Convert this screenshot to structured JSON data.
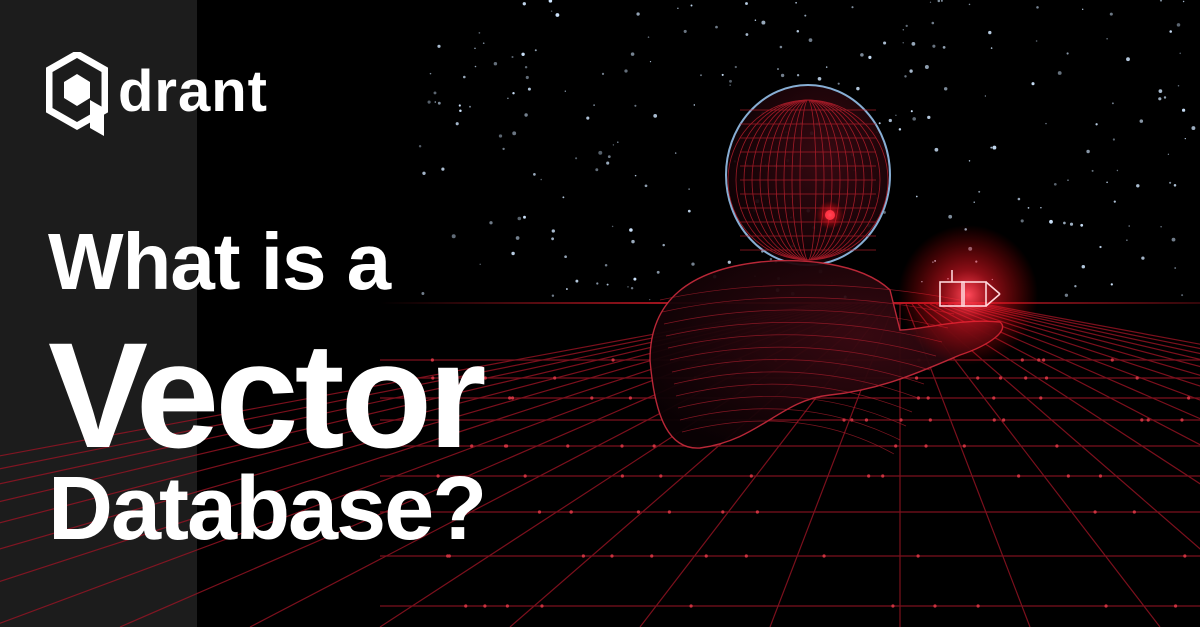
{
  "brand": {
    "name": "drant",
    "logo_icon": "qdrant-hexagon-q-icon",
    "colors": {
      "primary_text": "#ffffff",
      "accent_glow": "#ff1a3a",
      "panel_bg": "#1c1c1c",
      "background": "#000000"
    }
  },
  "headline": {
    "line1": "What is a",
    "line2": "Vector",
    "line3": "Database?"
  },
  "illustration": {
    "description_icon": "wireframe-figure-holding-glowing-cube-icon"
  }
}
